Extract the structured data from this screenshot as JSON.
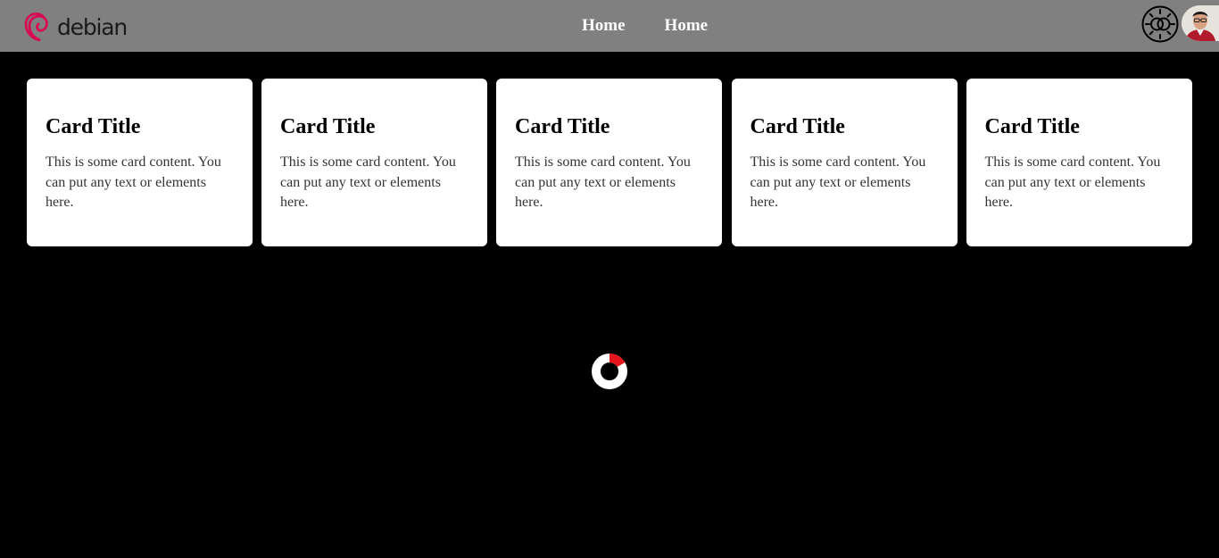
{
  "brand": {
    "name": "debian",
    "accent": "#d70a53"
  },
  "nav": {
    "links": [
      {
        "label": "Home"
      },
      {
        "label": "Home"
      }
    ]
  },
  "header_icons": {
    "theme_toggle": "sun-moon-icon",
    "avatar": "user-avatar"
  },
  "cards": [
    {
      "title": "Card Title",
      "text": "This is some card content. You can put any text or elements here."
    },
    {
      "title": "Card Title",
      "text": "This is some card content. You can put any text or elements here."
    },
    {
      "title": "Card Title",
      "text": "This is some card content. You can put any text or elements here."
    },
    {
      "title": "Card Title",
      "text": "This is some card content. You can put any text or elements here."
    },
    {
      "title": "Card Title",
      "text": "This is some card content. You can put any text or elements here."
    }
  ],
  "loader": {
    "icon": "loading-spinner-icon",
    "accent": "#e8141c"
  }
}
